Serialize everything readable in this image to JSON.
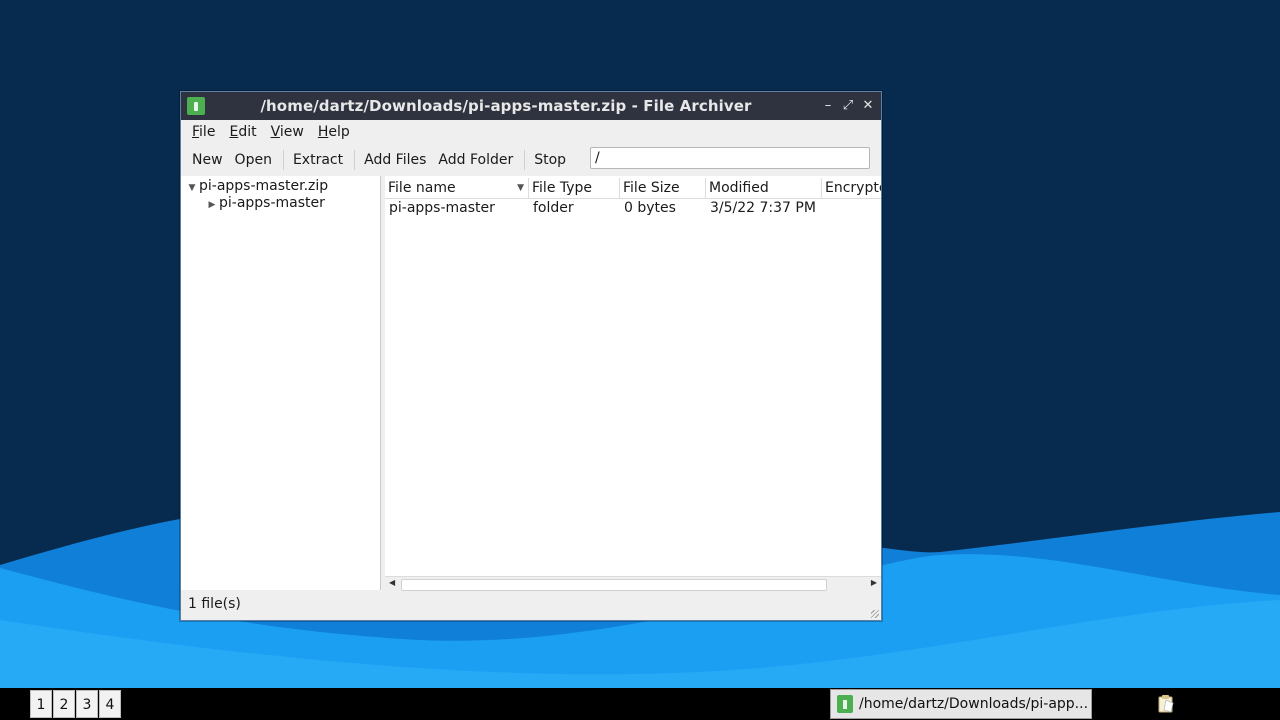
{
  "window": {
    "title": "/home/dartz/Downloads/pi-apps-master.zip - File Archiver",
    "controls": {
      "minimize": "–",
      "maximize": "⤢",
      "close": "✕"
    }
  },
  "menubar": {
    "items": [
      {
        "underline": "F",
        "rest": "ile"
      },
      {
        "underline": "E",
        "rest": "dit"
      },
      {
        "underline": "V",
        "rest": "iew"
      },
      {
        "underline": "H",
        "rest": "elp"
      }
    ]
  },
  "toolbar": {
    "new": "New",
    "open": "Open",
    "extract": "Extract",
    "add_files": "Add Files",
    "add_folder": "Add Folder",
    "stop": "Stop",
    "path_value": "/"
  },
  "tree": {
    "root": "pi-apps-master.zip",
    "child": "pi-apps-master",
    "expanded_arrow": "▼",
    "collapsed_arrow": "▶"
  },
  "file_list": {
    "columns": [
      "File name",
      "File Type",
      "File Size",
      "Modified",
      "Encrypte"
    ],
    "sort_arrow": "▼",
    "rows": [
      {
        "name": "pi-apps-master",
        "type": "folder",
        "size": "0 bytes",
        "modified": "3/5/22 7:37 PM",
        "encrypted": ""
      }
    ]
  },
  "scrollbar": {
    "left": "◀",
    "right": "▶"
  },
  "status": {
    "text": "1 file(s)"
  },
  "taskbar": {
    "workspaces": [
      "1",
      "2",
      "3",
      "4"
    ],
    "task_label": "/home/dartz/Downloads/pi-app..."
  },
  "colors": {
    "desktop_dark": "#062b4f",
    "wave_blue": "#1a9cf0",
    "titlebar": "#2f3340",
    "app_icon": "#4caf50"
  }
}
